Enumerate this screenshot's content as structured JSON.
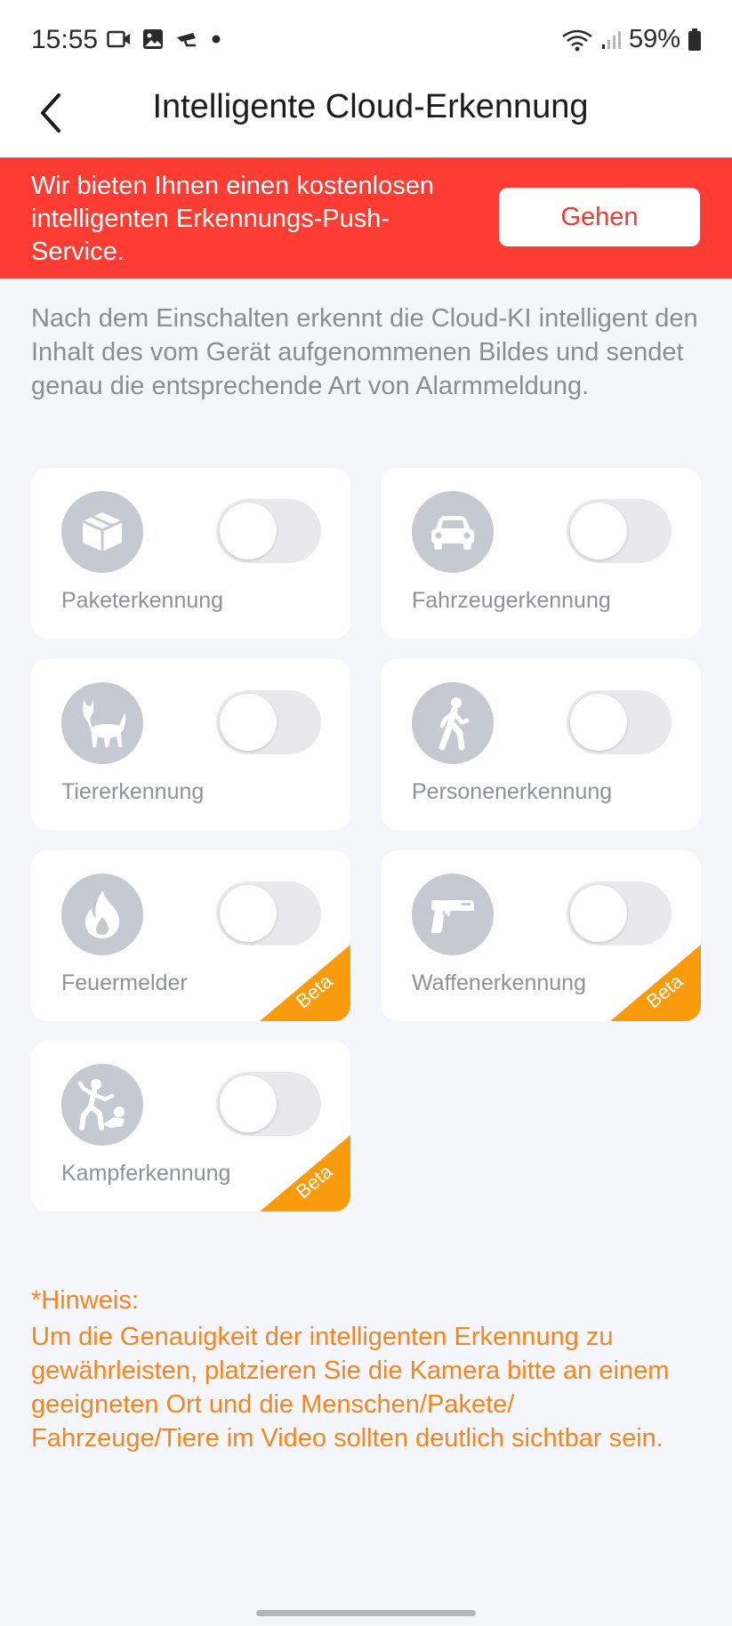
{
  "status_bar": {
    "time": "15:55",
    "battery": "59%"
  },
  "header": {
    "title": "Intelligente Cloud-Erkennung"
  },
  "promo": {
    "text": "Wir bieten Ihnen einen kostenlosen intelligenten Erkennungs-Push-Service.",
    "button": "Gehen"
  },
  "description": "Nach dem Einschalten erkennt die Cloud-KI intelligent den Inhalt des vom Gerät aufgenommenen Bildes und sendet genau die entsprechende Art von Alarmmeldung.",
  "features": [
    {
      "label": "Paketerkennung",
      "icon": "package-icon",
      "enabled": false,
      "beta": false
    },
    {
      "label": "Fahrzeugerkennung",
      "icon": "car-icon",
      "enabled": false,
      "beta": false
    },
    {
      "label": "Tiererkennung",
      "icon": "cat-icon",
      "enabled": false,
      "beta": false
    },
    {
      "label": "Personenerkennung",
      "icon": "person-walking-icon",
      "enabled": false,
      "beta": false
    },
    {
      "label": "Feuermelder",
      "icon": "flame-icon",
      "enabled": false,
      "beta": true
    },
    {
      "label": "Waffenerkennung",
      "icon": "gun-icon",
      "enabled": false,
      "beta": true
    },
    {
      "label": "Kampferkennung",
      "icon": "fight-icon",
      "enabled": false,
      "beta": true
    }
  ],
  "beta_label": "Beta",
  "hint": {
    "title": "*Hinweis:",
    "text": "Um die Genauigkeit der intelligenten Erkennung zu gewährleisten, platzieren Sie die Kamera bitte an einem geeigneten Ort und die Menschen/Pakete/ Fahrzeuge/Tiere im Video sollten deutlich sichtbar sein."
  },
  "colors": {
    "accent_red": "#fd3d34",
    "hint_orange": "#f5861f",
    "beta_orange": "#fa9b0e",
    "icon_gray": "#c5c9d2"
  }
}
